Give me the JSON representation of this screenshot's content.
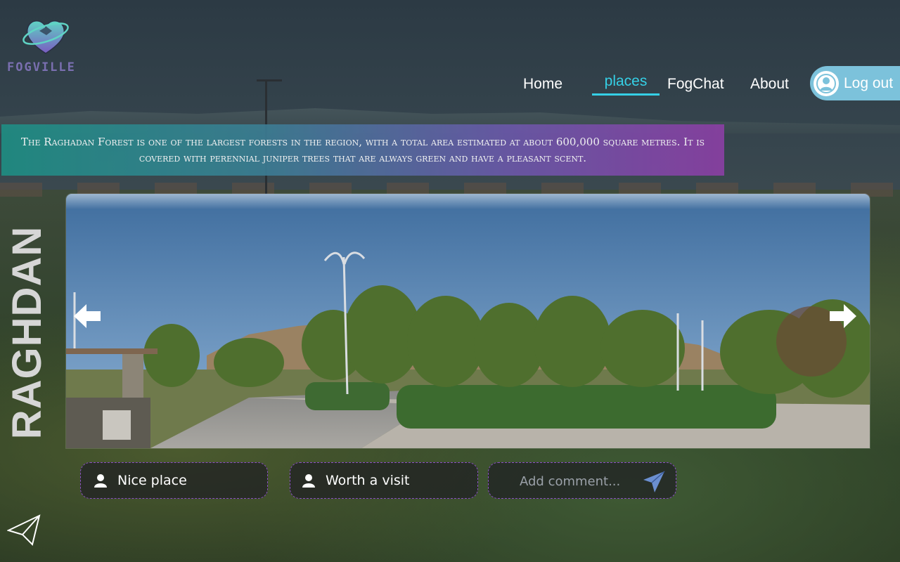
{
  "brand": {
    "name": "FOGVILLE",
    "logo_icon": "heart-globe-logo"
  },
  "nav": {
    "items": [
      {
        "label": "Home",
        "active": false
      },
      {
        "label": "places",
        "active": true
      },
      {
        "label": "FogChat",
        "active": false
      },
      {
        "label": "About",
        "active": false
      }
    ],
    "logout_label": "Log out",
    "accent": "#35d0e6"
  },
  "place": {
    "name": "RAGHDAN",
    "description": "The Raghadan Forest is one of the largest forests in the region, with a total area estimated at about 600,000 square metres. It is covered with perennial juniper trees that are always green and have a pleasant scent."
  },
  "gallery": {
    "prev_icon": "arrow-left-icon",
    "next_icon": "arrow-right-icon"
  },
  "comments": [
    {
      "text": "Nice place",
      "icon": "user-icon"
    },
    {
      "text": "Worth a visit",
      "icon": "user-icon"
    }
  ],
  "comment_input": {
    "placeholder": "Add comment...",
    "value": "",
    "send_icon": "send-icon"
  },
  "back_icon": "paper-plane-back-icon"
}
